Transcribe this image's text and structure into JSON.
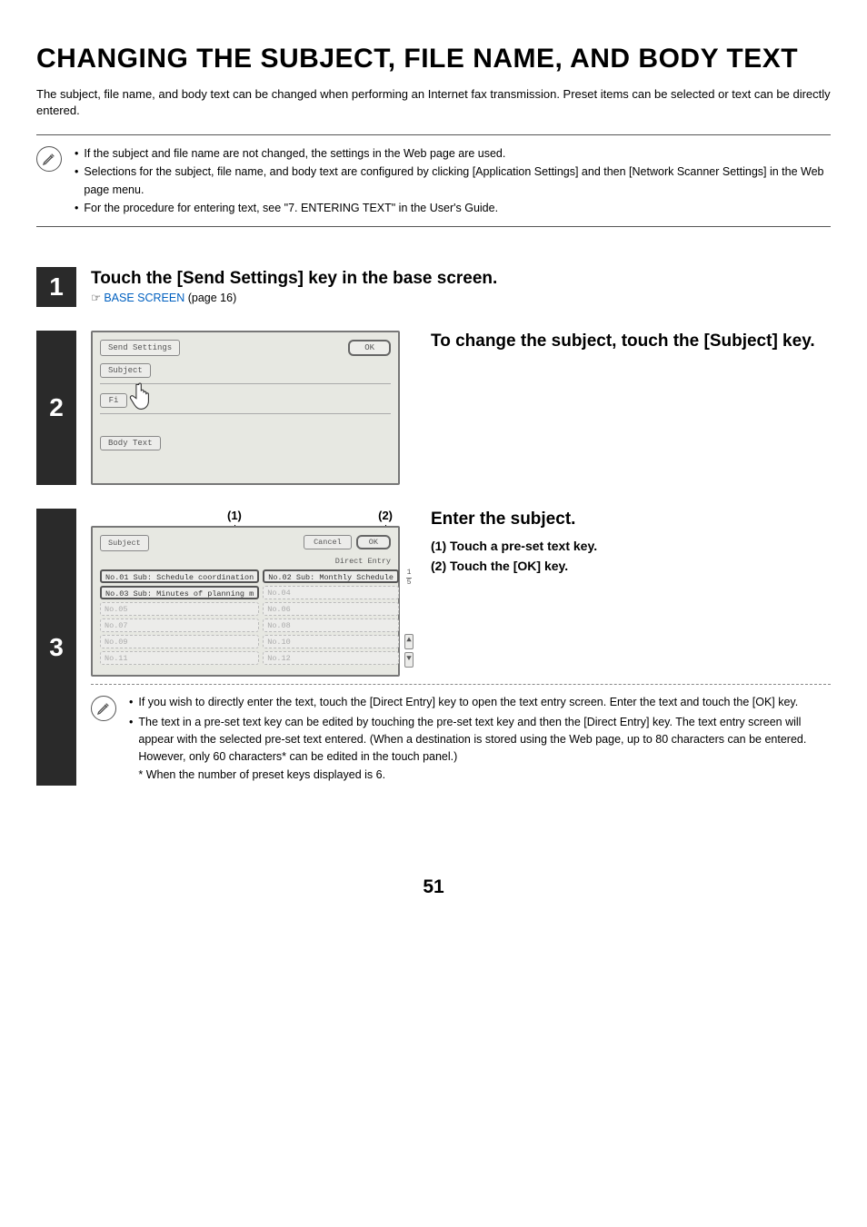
{
  "title": "CHANGING THE SUBJECT, FILE NAME, AND BODY TEXT",
  "intro": "The subject, file name, and body text can be changed when performing an Internet fax transmission. Preset items can be selected or text can be directly entered.",
  "notes": {
    "n1": "If the subject and file name are not changed, the settings in the Web page are used.",
    "n2": "Selections for the subject, file name, and body text are configured by clicking [Application Settings] and then [Network Scanner Settings] in the Web page menu.",
    "n3": "For the procedure for entering text, see \"7. ENTERING TEXT\" in the User's Guide."
  },
  "step1": {
    "num": "1",
    "heading": "Touch the [Send Settings] key in the base screen.",
    "link_prefix": "☞ ",
    "link_text": "BASE SCREEN",
    "link_suffix": " (page 16)"
  },
  "step2": {
    "num": "2",
    "lcd": {
      "title": "Send Settings",
      "ok": "OK",
      "subject": "Subject",
      "filename": "Fi",
      "bodytext": "Body Text"
    },
    "heading": "To change the subject, touch the [Subject] key."
  },
  "step3": {
    "num": "3",
    "callouts": {
      "c1": "(1)",
      "c2": "(2)"
    },
    "lcd": {
      "title": "Subject",
      "cancel": "Cancel",
      "ok": "OK",
      "direct_entry": "Direct Entry",
      "items_left": [
        {
          "label": "No.01 Sub: Schedule coordination",
          "state": "active"
        },
        {
          "label": "No.03 Sub: Minutes of planning m",
          "state": "active"
        },
        {
          "label": "No.05",
          "state": "disabled"
        },
        {
          "label": "No.07",
          "state": "disabled"
        },
        {
          "label": "No.09",
          "state": "disabled"
        },
        {
          "label": "No.11",
          "state": "disabled"
        }
      ],
      "items_right": [
        {
          "label": "No.02 Sub: Monthly Schedule",
          "state": "active"
        },
        {
          "label": "No.04",
          "state": "disabled"
        },
        {
          "label": "No.06",
          "state": "disabled"
        },
        {
          "label": "No.08",
          "state": "disabled"
        },
        {
          "label": "No.10",
          "state": "disabled"
        },
        {
          "label": "No.12",
          "state": "disabled"
        }
      ],
      "page_current": "1",
      "page_total": "5",
      "arrow_up": "⯅",
      "arrow_down": "⯆"
    },
    "heading": "Enter the subject.",
    "sub1": "(1)  Touch a pre-set text key.",
    "sub2": "(2)  Touch the [OK] key.",
    "subnote1": "If you wish to directly enter the text, touch the [Direct Entry] key to open the text entry screen. Enter the text and touch the [OK] key.",
    "subnote2": "The text in a pre-set text key can be edited by touching the pre-set text key and then the [Direct Entry] key. The text entry screen will appear with the selected pre-set text entered. (When a destination is stored using the Web page, up to 80 characters can be entered. However, only 60 characters* can be edited in the touch panel.)",
    "subnote2_star": "* When the number of preset keys displayed is 6."
  },
  "page_number": "51"
}
